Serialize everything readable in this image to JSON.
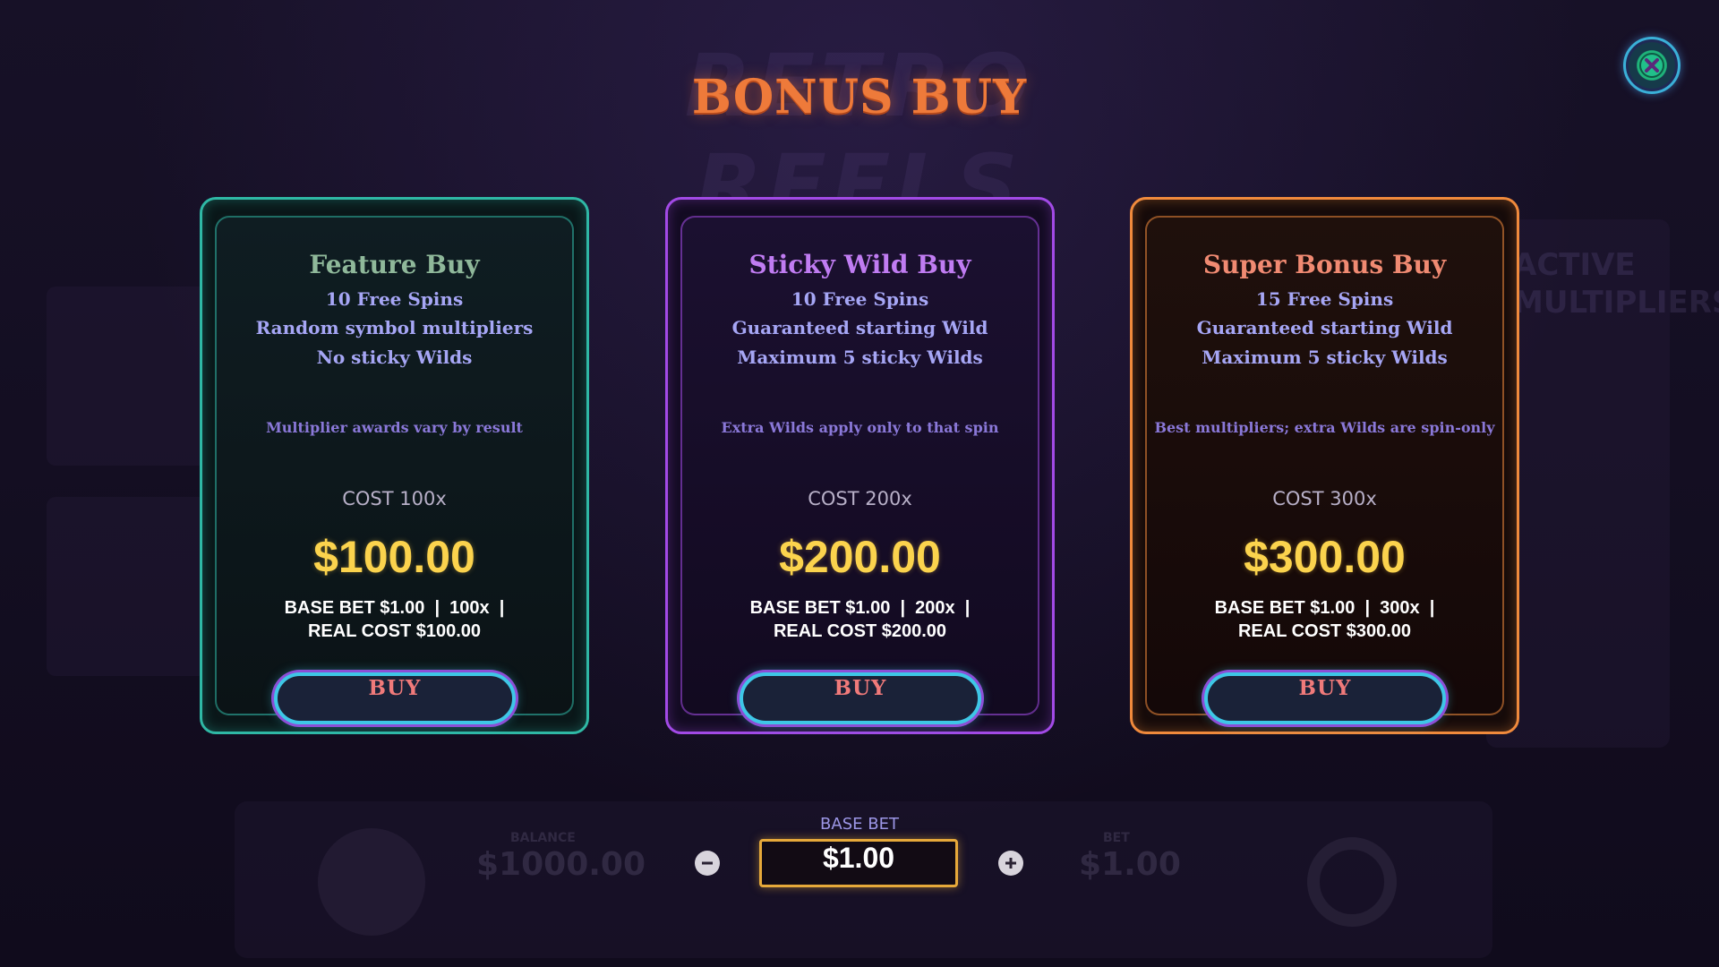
{
  "header": {
    "title": "BONUS BUY",
    "background_title": "RETRO REELS"
  },
  "background": {
    "right_panel_text": "ACTIVE MULTIPLIERS",
    "balance_label": "BALANCE",
    "balance_value": "$1000.00",
    "bet_label": "BET",
    "bet_value": "$1.00"
  },
  "cards": [
    {
      "name": "Feature Buy",
      "features": [
        "10 Free Spins",
        "Random symbol multipliers",
        "No sticky Wilds"
      ],
      "note": "Multiplier awards vary by result",
      "cost_label": "COST 100x",
      "price": "$100.00",
      "detail_line1": "BASE BET $1.00  |  100x  |",
      "detail_line2": "REAL COST $100.00",
      "buy_label": "BUY",
      "accent": "#2fb8a5"
    },
    {
      "name": "Sticky Wild Buy",
      "features": [
        "10 Free Spins",
        "Guaranteed starting Wild",
        "Maximum 5 sticky Wilds"
      ],
      "note": "Extra Wilds apply only to that spin",
      "cost_label": "COST 200x",
      "price": "$200.00",
      "detail_line1": "BASE BET $1.00  |  200x  |",
      "detail_line2": "REAL COST $200.00",
      "buy_label": "BUY",
      "accent": "#a24ae6"
    },
    {
      "name": "Super Bonus Buy",
      "features": [
        "15 Free Spins",
        "Guaranteed starting Wild",
        "Maximum 5 sticky Wilds"
      ],
      "note": "Best multipliers; extra Wilds are spin-only",
      "cost_label": "COST 300x",
      "price": "$300.00",
      "detail_line1": "BASE BET $1.00  |  300x  |",
      "detail_line2": "REAL COST $300.00",
      "buy_label": "BUY",
      "accent": "#f08a3c"
    }
  ],
  "base_bet": {
    "label": "BASE BET",
    "value": "$1.00",
    "decrease_icon": "minus-icon",
    "increase_icon": "plus-icon"
  },
  "close_icon": "close-icon"
}
